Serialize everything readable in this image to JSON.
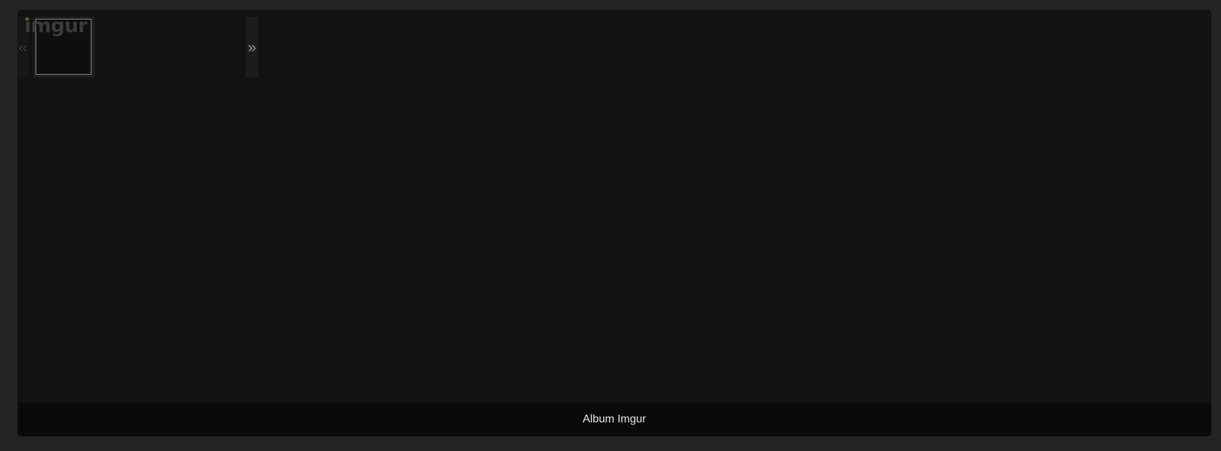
{
  "brand": {
    "logo_text": "imgur"
  },
  "navigation": {
    "prev_glyph": "«",
    "next_glyph": "»"
  },
  "thumbnails": [
    {
      "selected": true
    }
  ],
  "caption": {
    "text": "Album Imgur"
  },
  "colors": {
    "background": "#242424",
    "frame": "#121212",
    "caption_bar": "#0a0a0a",
    "logo": "#3a3a3a",
    "caption_text": "#e8e8e8"
  }
}
